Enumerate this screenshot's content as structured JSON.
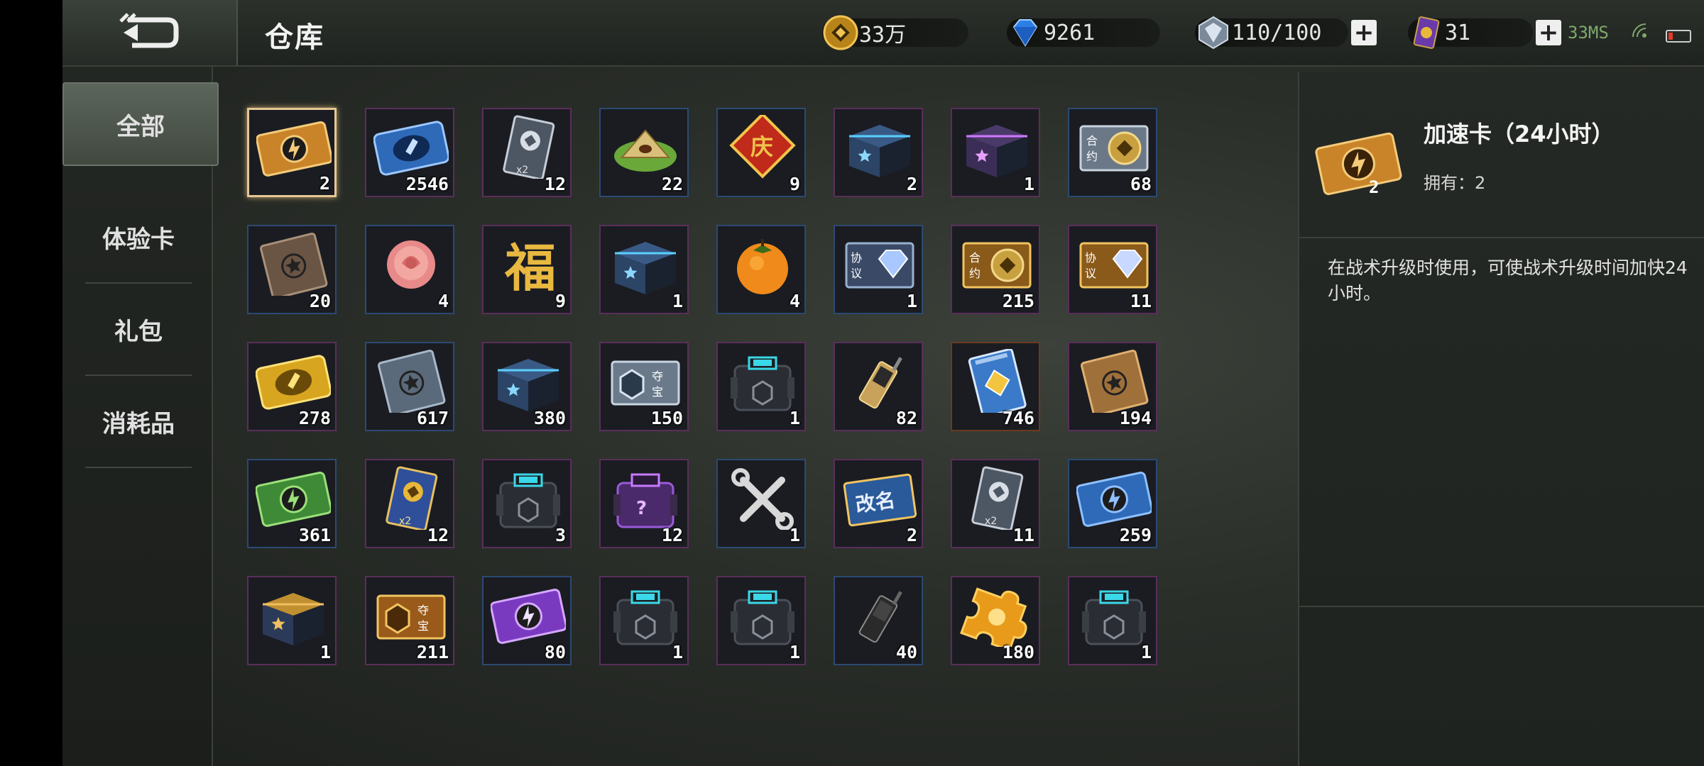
{
  "header": {
    "title": "仓库",
    "gold": "33万",
    "diamond": "9261",
    "stamina": "110/100",
    "tickets": "31",
    "ping": "33MS"
  },
  "sidebar": {
    "items": [
      {
        "label": "全部"
      },
      {
        "label": "体验卡"
      },
      {
        "label": "礼包"
      },
      {
        "label": "消耗品"
      }
    ]
  },
  "items": [
    {
      "count": "2",
      "icon": "speedup-card-orange"
    },
    {
      "count": "2546",
      "icon": "blue-ticket"
    },
    {
      "count": "12",
      "icon": "silver-x2-card"
    },
    {
      "count": "22",
      "icon": "zongzi"
    },
    {
      "count": "9",
      "icon": "celebrate-card"
    },
    {
      "count": "2",
      "icon": "blue-star-box"
    },
    {
      "count": "1",
      "icon": "purple-star-box"
    },
    {
      "count": "68",
      "icon": "contract-coin"
    },
    {
      "count": "20",
      "icon": "brown-star-book"
    },
    {
      "count": "4",
      "icon": "rose"
    },
    {
      "count": "9",
      "icon": "fortune-character"
    },
    {
      "count": "1",
      "icon": "blue-star-box"
    },
    {
      "count": "4",
      "icon": "persimmon"
    },
    {
      "count": "1",
      "icon": "protocol-diamond"
    },
    {
      "count": "215",
      "icon": "contract-coin-gold"
    },
    {
      "count": "11",
      "icon": "protocol-diamond-gold"
    },
    {
      "count": "278",
      "icon": "gold-ticket"
    },
    {
      "count": "617",
      "icon": "silver-star-book"
    },
    {
      "count": "380",
      "icon": "blue-star-box"
    },
    {
      "count": "150",
      "icon": "treasure-ticket"
    },
    {
      "count": "1",
      "icon": "supply-crate"
    },
    {
      "count": "82",
      "icon": "radio-gold"
    },
    {
      "count": "746",
      "icon": "blue-chip-card"
    },
    {
      "count": "194",
      "icon": "gold-star-book"
    },
    {
      "count": "361",
      "icon": "speedup-card-green"
    },
    {
      "count": "12",
      "icon": "gold-x2-card"
    },
    {
      "count": "3",
      "icon": "supply-crate"
    },
    {
      "count": "12",
      "icon": "purple-mystery-crate"
    },
    {
      "count": "1",
      "icon": "wrench-tools"
    },
    {
      "count": "2",
      "icon": "rename-card"
    },
    {
      "count": "11",
      "icon": "silver-x2-card"
    },
    {
      "count": "259",
      "icon": "speedup-card-blue"
    },
    {
      "count": "1",
      "icon": "gold-star-box"
    },
    {
      "count": "211",
      "icon": "treasure-ticket-gold"
    },
    {
      "count": "80",
      "icon": "speedup-card-purple"
    },
    {
      "count": "1",
      "icon": "supply-crate"
    },
    {
      "count": "1",
      "icon": "supply-crate"
    },
    {
      "count": "40",
      "icon": "radio-black"
    },
    {
      "count": "180",
      "icon": "gold-puzzle"
    },
    {
      "count": "1",
      "icon": "supply-crate"
    }
  ],
  "detail": {
    "name": "加速卡（24小时）",
    "count": "2",
    "owned": "拥有：2",
    "description": "在战术升级时使用，可使战术升级时间加快24小时。"
  }
}
